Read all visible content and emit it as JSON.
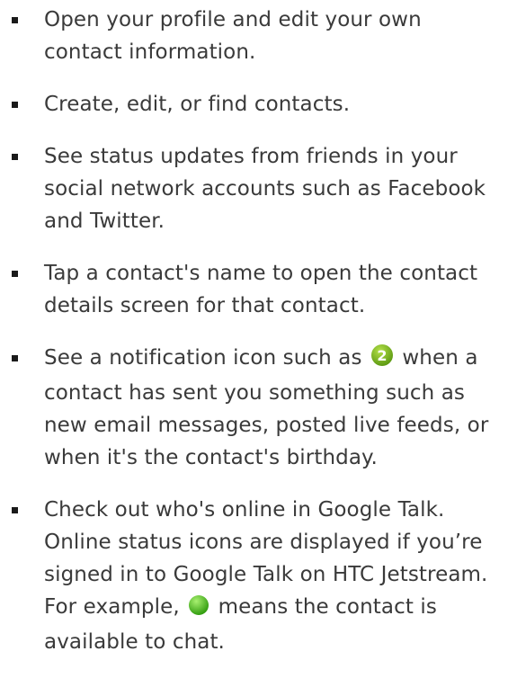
{
  "items": [
    {
      "text": "Open your profile and edit your own contact information."
    },
    {
      "text": "Create, edit, or find contacts."
    },
    {
      "text": "See status updates from friends in your social network accounts such as Facebook and Twitter."
    },
    {
      "text": "Tap a contact's name to open the contact details screen for that contact."
    },
    {
      "before": "See a notification icon such as",
      "badge": "2",
      "after": "when a contact has sent you something such as new email messages, posted live feeds, or when it's the contact's birthday."
    },
    {
      "before": "Check out who's online in Google Talk. Online status icons are displayed if you’re signed in to Google Talk on HTC Jetstream. For example,",
      "after": "means the contact is available to chat."
    }
  ],
  "icons": {
    "notification_badge": "notification-count-badge-icon",
    "online_status": "online-status-icon"
  },
  "colors": {
    "text": "#3a3a3a",
    "badge_green": "#7ab51d",
    "online_green": "#3fae17"
  }
}
